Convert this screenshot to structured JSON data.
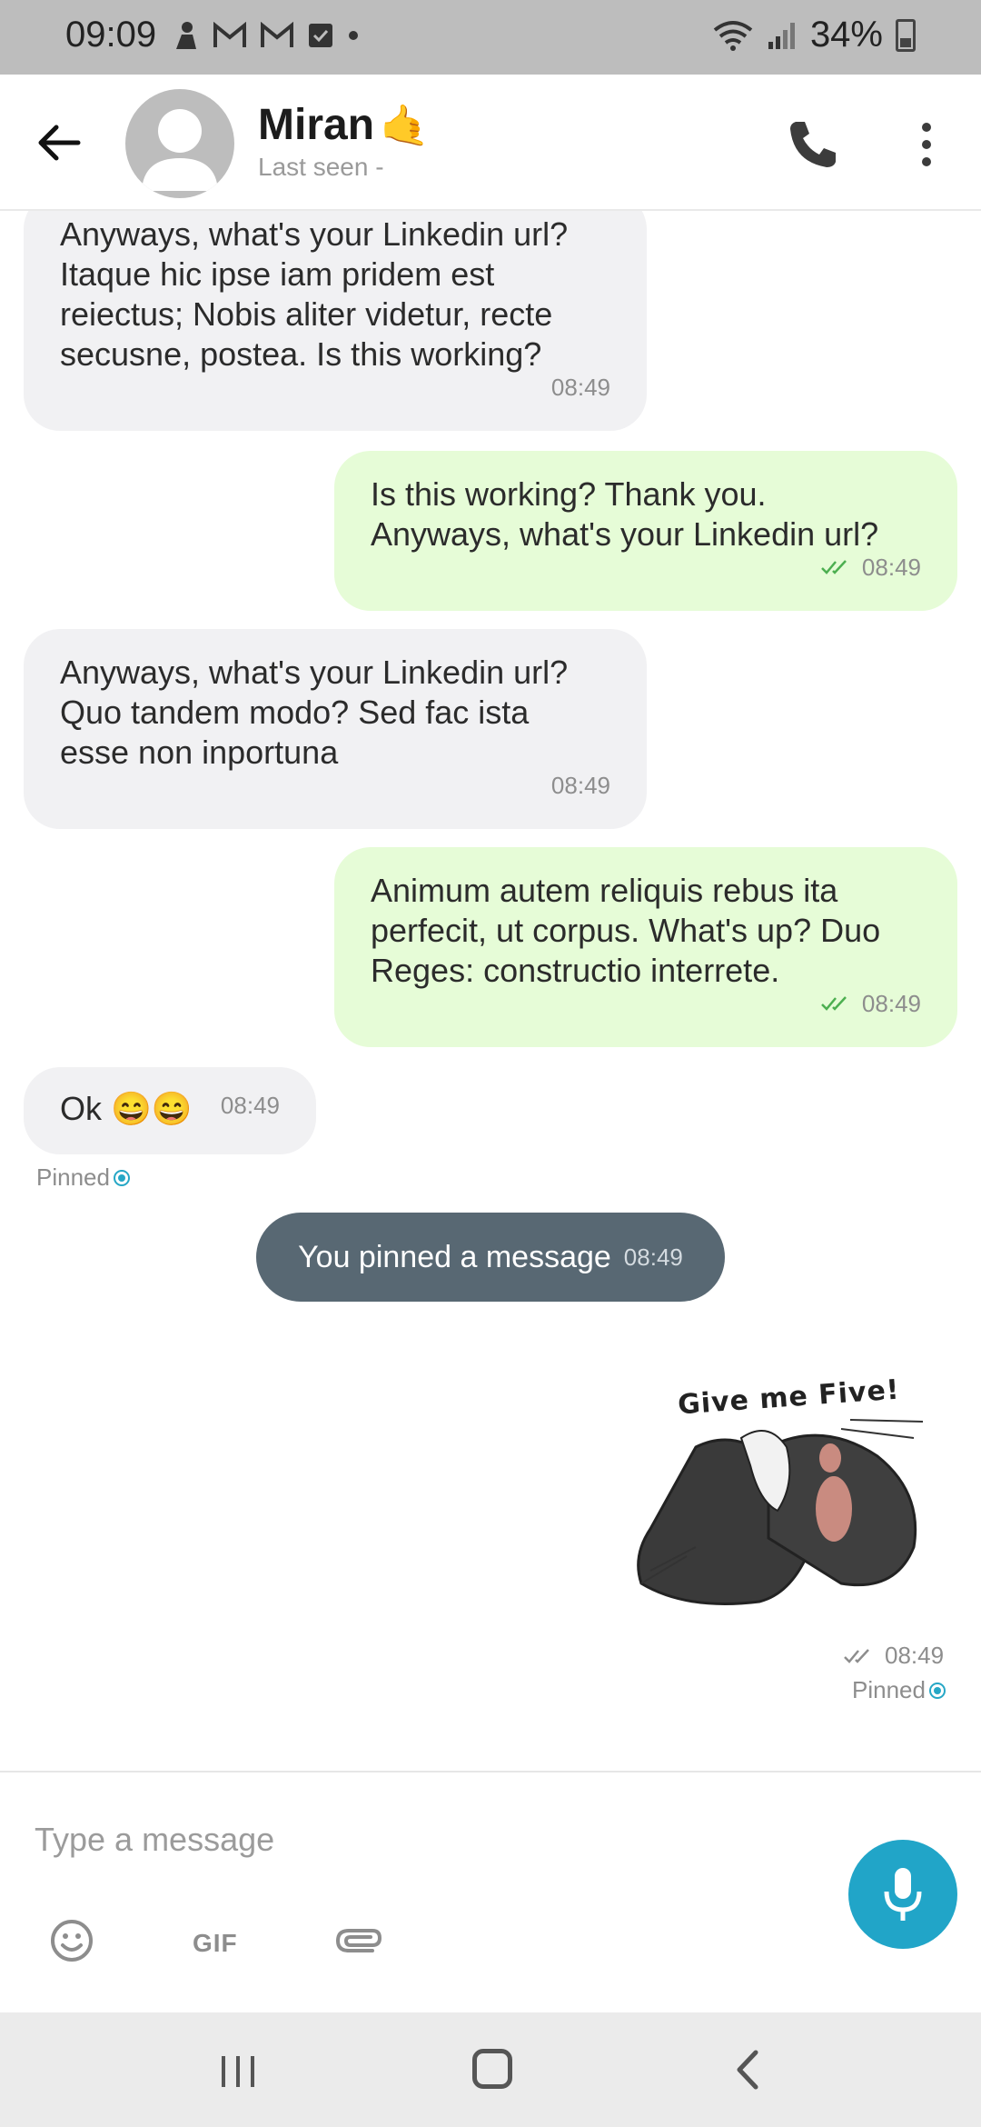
{
  "status_bar": {
    "time": "09:09",
    "battery": "34%",
    "notification_icons": [
      "person-icon",
      "gmail-icon",
      "gmail-icon",
      "checkbox-icon",
      "dot-icon"
    ]
  },
  "header": {
    "contact_name": "Miran",
    "contact_emoji": "🤙",
    "last_seen": "Last seen -"
  },
  "messages": [
    {
      "direction": "in",
      "text": "Anyways, what's your Linkedin url?\nItaque hic ipse iam pridem est\nreiectus; Nobis aliter videtur, recte\nsecusne, postea. Is this working?",
      "time": "08:49"
    },
    {
      "direction": "out",
      "text": "Is this working? Thank you.\nAnyways, what's your Linkedin url?",
      "time": "08:49"
    },
    {
      "direction": "in",
      "text": "Anyways, what's your Linkedin url?\nQuo tandem modo? Sed fac ista\nesse non inportuna",
      "time": "08:49"
    },
    {
      "direction": "out",
      "text": "Animum autem reliquis rebus ita\nperfecit, ut corpus. What's up? Duo\nReges: constructio interrete.",
      "time": "08:49"
    },
    {
      "direction": "in",
      "text": "Ok 😄😄",
      "time": "08:49",
      "pinned_label": "Pinned"
    }
  ],
  "system_message": {
    "text": "You pinned a message",
    "time": "08:49"
  },
  "sticker_message": {
    "sticker_text": "Give me Five!",
    "time": "08:49",
    "pinned_label": "Pinned"
  },
  "composer": {
    "placeholder": "Type a message",
    "gif_label": "GIF"
  },
  "colors": {
    "accent": "#21a5c8",
    "incoming_bubble": "#f1f1f3",
    "outgoing_bubble": "#e6fcd7",
    "system_pill": "#586873",
    "tick_green": "#4caf50"
  }
}
